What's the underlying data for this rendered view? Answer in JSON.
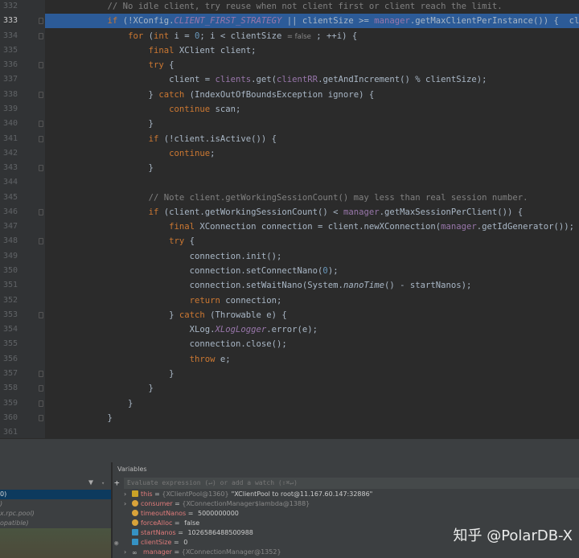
{
  "editor": {
    "highlight_line": 333,
    "lines": [
      {
        "n": "332",
        "fold": false,
        "seg": [
          [
            "            ",
            ""
          ],
          [
            "// No idle client, try reuse when not client first or client reach the limit.",
            "cm"
          ]
        ]
      },
      {
        "n": "333",
        "fold": true,
        "seg": [
          [
            "            ",
            ""
          ],
          [
            "if",
            "kw"
          ],
          [
            " (!XConfig.",
            ""
          ],
          [
            "CLIENT_FIRST_STRATEGY",
            "st"
          ],
          [
            " || clientSize >= ",
            ""
          ],
          [
            "manager",
            "fd"
          ],
          [
            ".getMaxClientPerInstance()) {  cl",
            ""
          ]
        ]
      },
      {
        "n": "334",
        "fold": true,
        "seg": [
          [
            "                ",
            ""
          ],
          [
            "for",
            "kw"
          ],
          [
            " (",
            ""
          ],
          [
            "int",
            "kw"
          ],
          [
            " i = ",
            ""
          ],
          [
            "0",
            "nm"
          ],
          [
            "; i < clientSize ",
            ""
          ],
          [
            "= false",
            "hint"
          ],
          [
            " ; ++i) {",
            ""
          ]
        ]
      },
      {
        "n": "335",
        "fold": false,
        "seg": [
          [
            "                    ",
            ""
          ],
          [
            "final",
            "kw"
          ],
          [
            " XClient client;",
            ""
          ]
        ]
      },
      {
        "n": "336",
        "fold": true,
        "seg": [
          [
            "                    ",
            ""
          ],
          [
            "try",
            "kw"
          ],
          [
            " {",
            ""
          ]
        ]
      },
      {
        "n": "337",
        "fold": false,
        "seg": [
          [
            "                        client = ",
            ""
          ],
          [
            "clients",
            "fd"
          ],
          [
            ".get(",
            ""
          ],
          [
            "clientRR",
            "fd"
          ],
          [
            ".getAndIncrement() % clientSize);",
            ""
          ]
        ]
      },
      {
        "n": "338",
        "fold": true,
        "seg": [
          [
            "                    } ",
            ""
          ],
          [
            "catch",
            "kw"
          ],
          [
            " (IndexOutOfBoundsException ignore) {",
            ""
          ]
        ]
      },
      {
        "n": "339",
        "fold": false,
        "seg": [
          [
            "                        ",
            ""
          ],
          [
            "continue",
            "kw"
          ],
          [
            " scan;",
            ""
          ]
        ]
      },
      {
        "n": "340",
        "fold": true,
        "seg": [
          [
            "                    }",
            ""
          ]
        ]
      },
      {
        "n": "341",
        "fold": true,
        "seg": [
          [
            "                    ",
            ""
          ],
          [
            "if",
            "kw"
          ],
          [
            " (!client.isActive()) {",
            ""
          ]
        ]
      },
      {
        "n": "342",
        "fold": false,
        "seg": [
          [
            "                        ",
            ""
          ],
          [
            "continue",
            "kw"
          ],
          [
            ";",
            ""
          ]
        ]
      },
      {
        "n": "343",
        "fold": true,
        "seg": [
          [
            "                    }",
            ""
          ]
        ]
      },
      {
        "n": "344",
        "fold": false,
        "seg": []
      },
      {
        "n": "345",
        "fold": false,
        "seg": [
          [
            "                    ",
            ""
          ],
          [
            "// Note client.getWorkingSessionCount() may less than real session number.",
            "cm"
          ]
        ]
      },
      {
        "n": "346",
        "fold": true,
        "seg": [
          [
            "                    ",
            ""
          ],
          [
            "if",
            "kw"
          ],
          [
            " (client.getWorkingSessionCount() < ",
            ""
          ],
          [
            "manager",
            "fd"
          ],
          [
            ".getMaxSessionPerClient()) {",
            ""
          ]
        ]
      },
      {
        "n": "347",
        "fold": false,
        "seg": [
          [
            "                        ",
            ""
          ],
          [
            "final",
            "kw"
          ],
          [
            " XConnection connection = client.newXConnection(",
            ""
          ],
          [
            "manager",
            "fd"
          ],
          [
            ".getIdGenerator());",
            ""
          ]
        ]
      },
      {
        "n": "348",
        "fold": true,
        "seg": [
          [
            "                        ",
            ""
          ],
          [
            "try",
            "kw"
          ],
          [
            " {",
            ""
          ]
        ]
      },
      {
        "n": "349",
        "fold": false,
        "seg": [
          [
            "                            connection.init();",
            ""
          ]
        ]
      },
      {
        "n": "350",
        "fold": false,
        "seg": [
          [
            "                            connection.setConnectNano(",
            ""
          ],
          [
            "0",
            "nm"
          ],
          [
            ");",
            ""
          ]
        ]
      },
      {
        "n": "351",
        "fold": false,
        "seg": [
          [
            "                            connection.setWaitNano(System.",
            ""
          ],
          [
            "nanoTime",
            "it"
          ],
          [
            "() - startNanos);",
            ""
          ]
        ]
      },
      {
        "n": "352",
        "fold": false,
        "seg": [
          [
            "                            ",
            ""
          ],
          [
            "return",
            "kw"
          ],
          [
            " connection;",
            ""
          ]
        ]
      },
      {
        "n": "353",
        "fold": true,
        "seg": [
          [
            "                        } ",
            ""
          ],
          [
            "catch",
            "kw"
          ],
          [
            " (Throwable e) {",
            ""
          ]
        ]
      },
      {
        "n": "354",
        "fold": false,
        "seg": [
          [
            "                            XLog.",
            ""
          ],
          [
            "XLogLogger",
            "st"
          ],
          [
            ".error(e);",
            ""
          ]
        ]
      },
      {
        "n": "355",
        "fold": false,
        "seg": [
          [
            "                            connection.close();",
            ""
          ]
        ]
      },
      {
        "n": "356",
        "fold": false,
        "seg": [
          [
            "                            ",
            ""
          ],
          [
            "throw",
            "kw"
          ],
          [
            " e;",
            ""
          ]
        ]
      },
      {
        "n": "357",
        "fold": true,
        "seg": [
          [
            "                        }",
            ""
          ]
        ]
      },
      {
        "n": "358",
        "fold": true,
        "seg": [
          [
            "                    }",
            ""
          ]
        ]
      },
      {
        "n": "359",
        "fold": true,
        "seg": [
          [
            "                }",
            ""
          ]
        ]
      },
      {
        "n": "360",
        "fold": true,
        "seg": [
          [
            "            }",
            ""
          ]
        ]
      },
      {
        "n": "361",
        "fold": false,
        "seg": []
      }
    ]
  },
  "frames": {
    "rows": [
      "0)",
      ")",
      "x.rpc.pool)",
      "opatible)"
    ]
  },
  "variables": {
    "title": "Variables",
    "eval_placeholder": "Evaluate expression (↵) or add a watch (⇧⌘↵)",
    "rows": [
      {
        "expand": true,
        "icon": "field-list-icon",
        "icon_color": "#c9a227",
        "name": "this",
        "type": "{XClientPool@1360}",
        "value": "\"XClientPool to root@11.167.60.147:32886\""
      },
      {
        "expand": true,
        "icon": "field-object-icon",
        "icon_color": "#d9a33a",
        "name": "consumer",
        "type": "{XConnectionManager$lambda@1388}",
        "value": ""
      },
      {
        "expand": false,
        "icon": "field-object-icon",
        "icon_color": "#d9a33a",
        "name": "timeoutNanos",
        "type": "",
        "value": "5000000000"
      },
      {
        "expand": false,
        "icon": "field-object-icon",
        "icon_color": "#d9a33a",
        "name": "forceAlloc",
        "type": "",
        "value": "false"
      },
      {
        "expand": false,
        "icon": "local-var-icon",
        "icon_color": "#3592c4",
        "name": "startNanos",
        "type": "",
        "value": "1026586488500988"
      },
      {
        "expand": false,
        "icon": "local-var-icon",
        "icon_color": "#3592c4",
        "name": "clientSize",
        "type": "",
        "value": "0"
      },
      {
        "expand": true,
        "icon": "watch-infinity-icon",
        "icon_color": "#bbbbbb",
        "name": "manager",
        "type": "{XConnectionManager@1352}",
        "value": ""
      }
    ]
  },
  "watermark": "知乎 @PolarDB-X"
}
